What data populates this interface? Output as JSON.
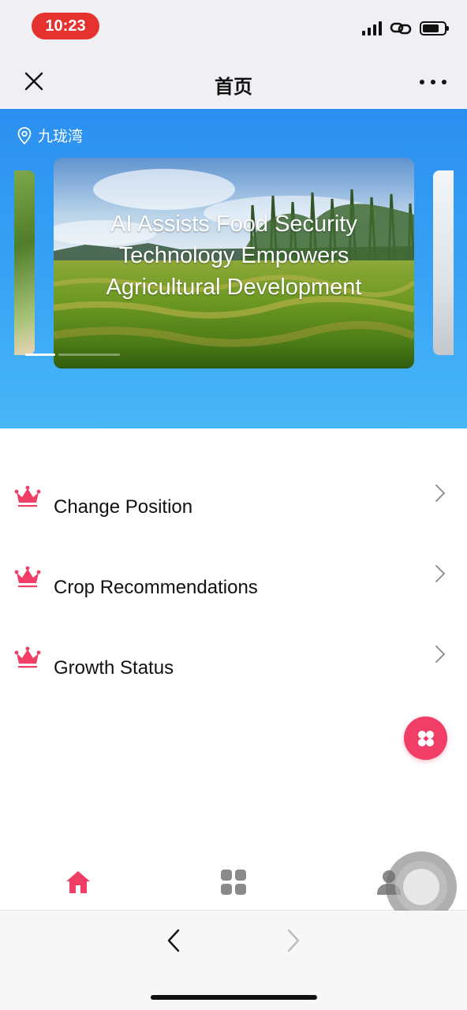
{
  "status_bar": {
    "time": "10:23"
  },
  "nav": {
    "title": "首页"
  },
  "header": {
    "location": "九珑湾",
    "banner": {
      "caption_lines": [
        "AI Assists Food Security",
        "Technology Empowers",
        "Agricultural Development"
      ],
      "slide_count": 2,
      "active_slide": 1
    }
  },
  "menu": {
    "items": [
      {
        "label": "Change Position"
      },
      {
        "label": "Crop Recommendations"
      },
      {
        "label": "Growth Status"
      }
    ]
  },
  "colors": {
    "accent": "#f03e66",
    "header_blue": "#2b8ff0",
    "time_pill": "#e5322f"
  },
  "icons": {
    "close": "close-icon",
    "more": "more-icon",
    "location": "location-pin-icon",
    "menu_item": "crown-icon",
    "chevron": "chevron-right-icon",
    "fab": "four-petal-icon",
    "tab_home": "home-icon",
    "tab_apps": "grid-icon",
    "tab_profile": "person-icon"
  }
}
